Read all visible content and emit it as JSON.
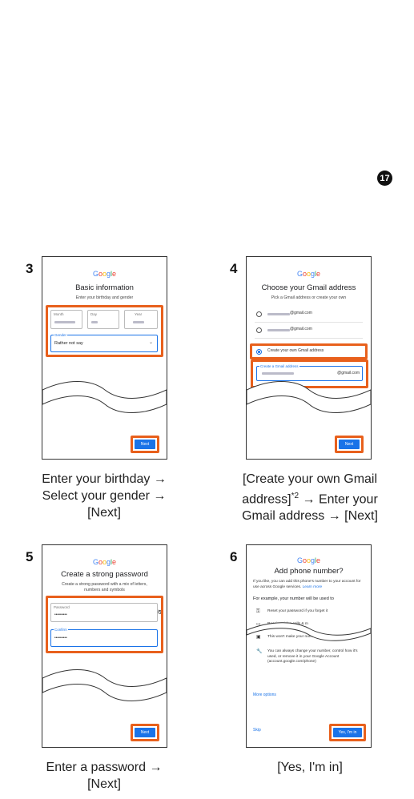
{
  "page_number": "17",
  "steps": [
    {
      "number": "3",
      "logo": "Google",
      "title": "Basic information",
      "subtitle": "Enter your birthday and gender",
      "month_label": "Month",
      "day_label": "Day",
      "year_label": "Year",
      "gender_label": "Gender",
      "gender_value": "Rather not say",
      "next_label": "Next",
      "caption_lines": [
        "Enter your birthday →",
        "Select your gender →",
        "[Next]"
      ]
    },
    {
      "number": "4",
      "logo": "Google",
      "title": "Choose your Gmail address",
      "subtitle": "Pick a Gmail address or create your own",
      "option1": "@gmail.com",
      "option2": "@gmail.com",
      "option3": "Create your own Gmail address",
      "create_label": "Create a Gmail address",
      "domain_suffix": "@gmail.com",
      "next_label": "Next",
      "caption_line1": "[Create your own Gmail",
      "caption_line2_pre": "address]",
      "caption_sup": "*2",
      "caption_line2_post": " → Enter your",
      "caption_line3": "Gmail address → [Next]"
    },
    {
      "number": "5",
      "logo": "Google",
      "title": "Create a strong password",
      "subtitle": "Create a strong password with a mix of letters, numbers and symbols",
      "password_label": "Password",
      "password_value": "•••••••••",
      "confirm_label": "Confirm",
      "confirm_value": "•••••••••",
      "next_label": "Next",
      "caption_lines": [
        "Enter a password →",
        "[Next]"
      ]
    },
    {
      "number": "6",
      "logo": "Google",
      "title": "Add phone number?",
      "intro": "If you like, you can add this phone's number to your account for use across Google services.",
      "learn_more": "Learn more",
      "example_heading": "For example, your number will be used to",
      "item1": "Reset your password if you forget it",
      "item2": "Receive video calls & m",
      "item3": "This won't make your number public",
      "item4": "You can always change your number, control how it's used, or remove it in your Google Account (account.google.com/phone)",
      "more_options": "More options",
      "skip": "Skip",
      "yes_label": "Yes, I'm in",
      "caption_lines": [
        "[Yes, I'm in]"
      ]
    }
  ],
  "colors": {
    "highlight": "#e8601c",
    "google_blue": "#1a73e8"
  }
}
